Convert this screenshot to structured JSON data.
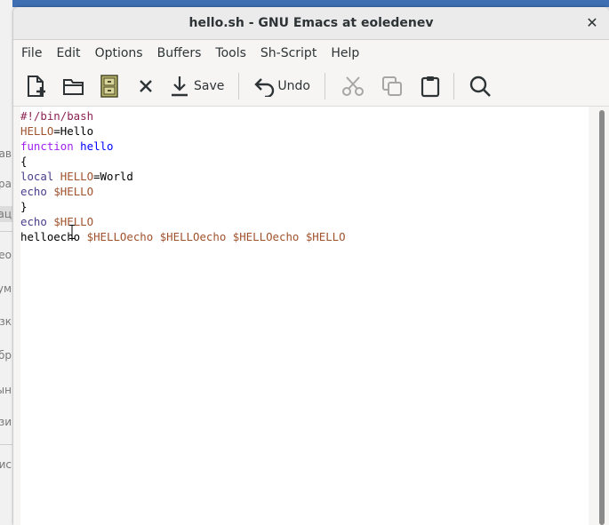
{
  "background_app": {
    "sidebar_fragments": [
      "ав",
      "ра",
      "ац",
      "ео",
      "ум",
      "рузк",
      "бр",
      "ын",
      "зи",
      "гис"
    ]
  },
  "window": {
    "title": "hello.sh - GNU Emacs at eoledenev",
    "close_glyph": "✕"
  },
  "menubar": {
    "items": [
      "File",
      "Edit",
      "Options",
      "Buffers",
      "Tools",
      "Sh-Script",
      "Help"
    ]
  },
  "toolbar": {
    "save_label": "Save",
    "undo_label": "Undo",
    "icons": [
      "new-file-icon",
      "open-folder-icon",
      "file-cabinet-icon",
      "close-icon",
      "save-icon",
      "undo-icon",
      "cut-icon",
      "copy-icon",
      "paste-icon",
      "search-icon"
    ]
  },
  "editor": {
    "lines": [
      [
        {
          "t": "#!/bin/bash",
          "c": "comment"
        }
      ],
      [
        {
          "t": "HELLO",
          "c": "var"
        },
        {
          "t": "=Hello",
          "c": ""
        }
      ],
      [
        {
          "t": "function",
          "c": "kw"
        },
        {
          "t": " ",
          "c": ""
        },
        {
          "t": "hello",
          "c": "fn"
        }
      ],
      [
        {
          "t": "{",
          "c": ""
        }
      ],
      [
        {
          "t": "local",
          "c": "builtin"
        },
        {
          "t": " ",
          "c": ""
        },
        {
          "t": "HELLO",
          "c": "var"
        },
        {
          "t": "=World",
          "c": ""
        }
      ],
      [
        {
          "t": "echo",
          "c": "builtin"
        },
        {
          "t": " ",
          "c": ""
        },
        {
          "t": "$HELLO",
          "c": "var"
        }
      ],
      [
        {
          "t": "}",
          "c": ""
        }
      ],
      [
        {
          "t": "echo",
          "c": "builtin"
        },
        {
          "t": " ",
          "c": ""
        },
        {
          "t": "$HELLO",
          "c": "var"
        }
      ],
      [
        {
          "t": "helloecho ",
          "c": ""
        },
        {
          "t": "$HELLOecho",
          "c": "var"
        },
        {
          "t": " ",
          "c": ""
        },
        {
          "t": "$HELLOecho",
          "c": "var"
        },
        {
          "t": " ",
          "c": ""
        },
        {
          "t": "$HELLOecho",
          "c": "var"
        },
        {
          "t": " ",
          "c": ""
        },
        {
          "t": "$HELLO",
          "c": "var"
        }
      ]
    ]
  },
  "colors": {
    "comment": "#8b2252",
    "var": "#a0522d",
    "kw": "#a020f0",
    "fn": "#0000ff",
    "builtin": "#483d8b"
  }
}
